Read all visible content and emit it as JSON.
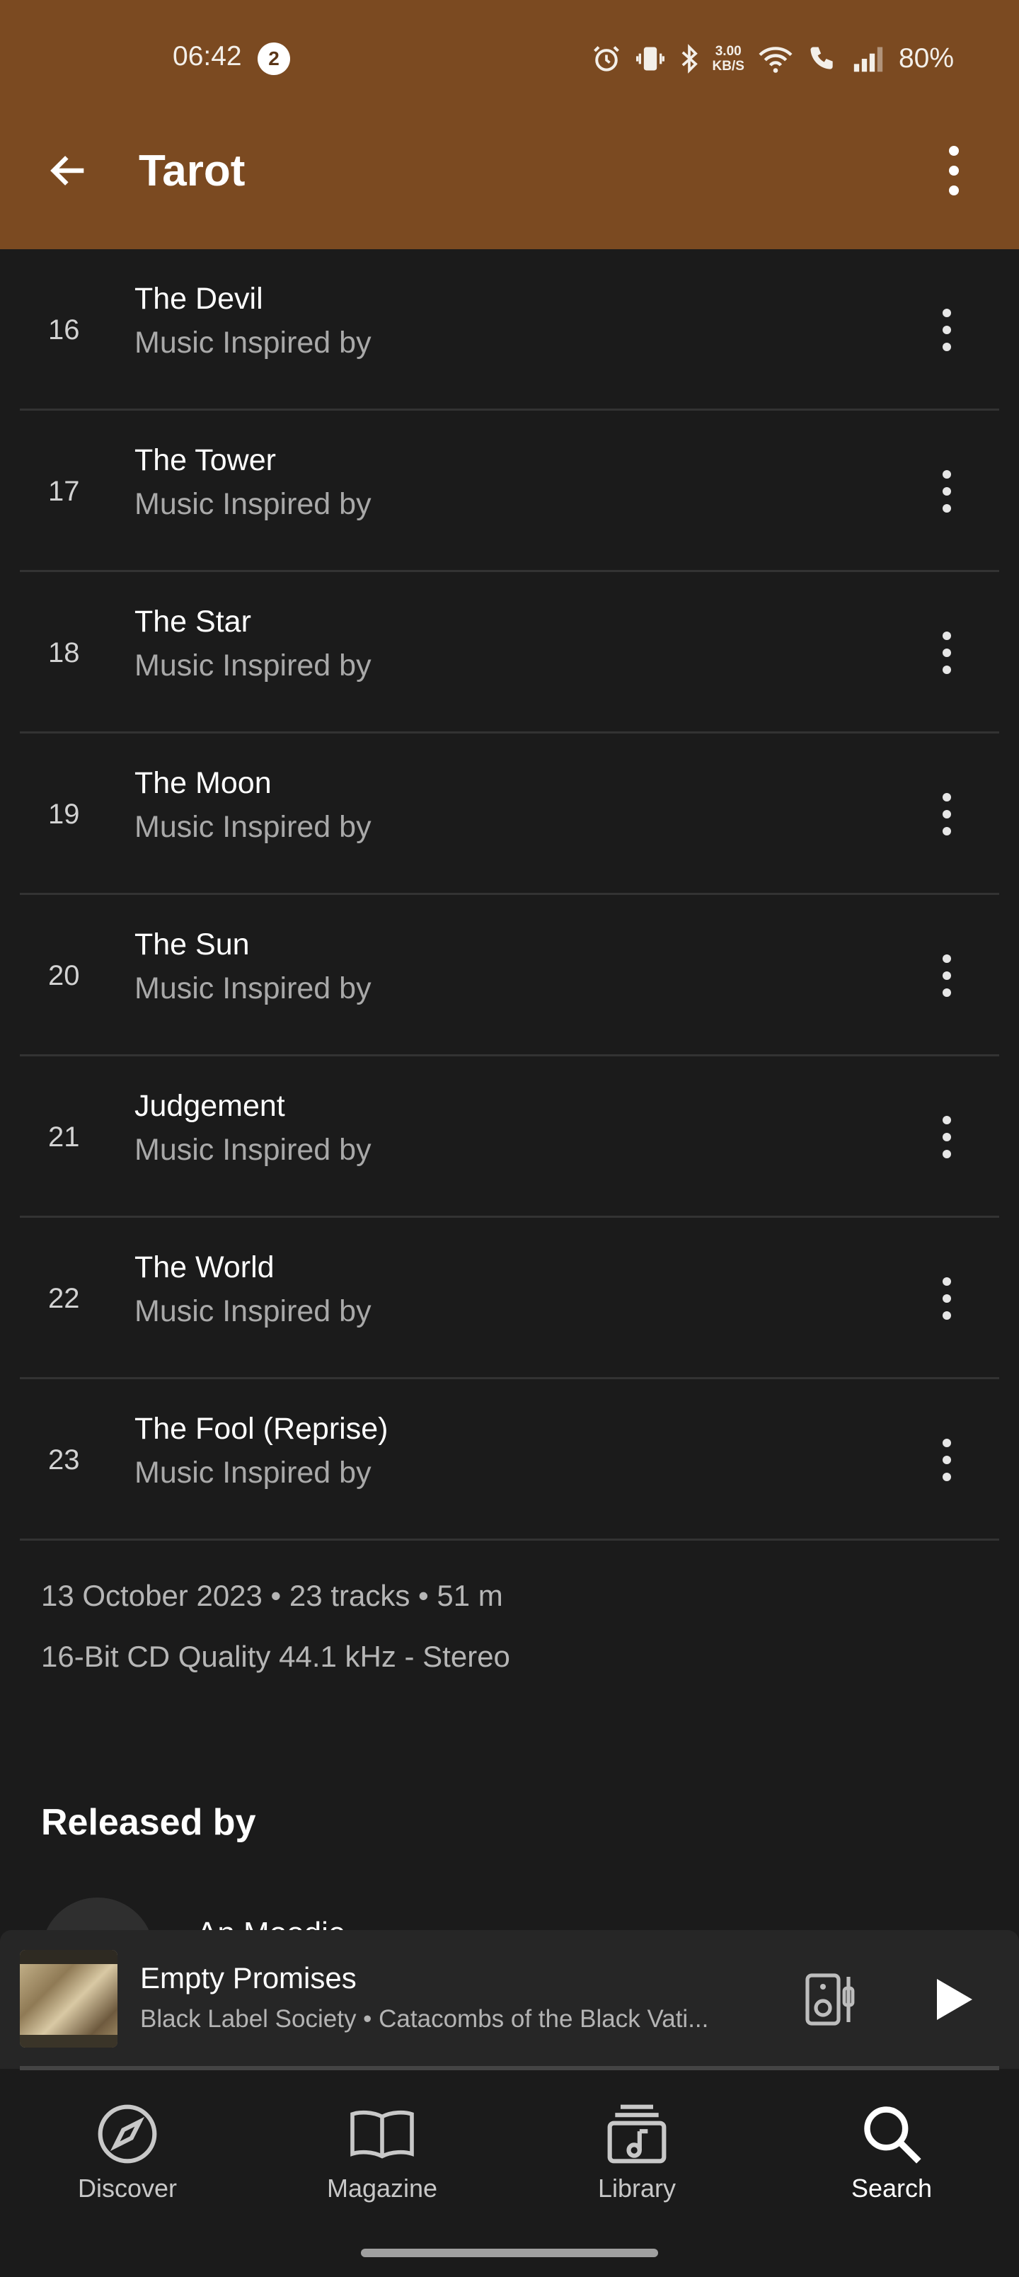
{
  "status_bar": {
    "time": "06:42",
    "notification_count": "2",
    "net_speed_value": "3.00",
    "net_speed_unit": "KB/S",
    "battery": "80%"
  },
  "header": {
    "title": "Tarot",
    "background_color": "#7b4a21"
  },
  "tracks": [
    {
      "number": "16",
      "title": "The Devil",
      "subtitle": "Music Inspired by"
    },
    {
      "number": "17",
      "title": "The Tower",
      "subtitle": "Music Inspired by"
    },
    {
      "number": "18",
      "title": "The Star",
      "subtitle": "Music Inspired by"
    },
    {
      "number": "19",
      "title": "The Moon",
      "subtitle": "Music Inspired by"
    },
    {
      "number": "20",
      "title": "The Sun",
      "subtitle": "Music Inspired by"
    },
    {
      "number": "21",
      "title": "Judgement",
      "subtitle": "Music Inspired by"
    },
    {
      "number": "22",
      "title": "The World",
      "subtitle": "Music Inspired by"
    },
    {
      "number": "23",
      "title": "The Fool (Reprise)",
      "subtitle": "Music Inspired by"
    }
  ],
  "album_meta": {
    "release_info": "13 October 2023 • 23 tracks • 51 m",
    "quality": "16-Bit CD Quality 44.1 kHz - Stereo"
  },
  "released_by": {
    "heading": "Released by",
    "artist_name_partial": "An Moodie"
  },
  "mini_player": {
    "title": "Empty Promises",
    "subtitle": "Black Label Society • Catacombs of the Black Vati..."
  },
  "bottom_nav": [
    {
      "label": "Discover",
      "icon": "compass-icon"
    },
    {
      "label": "Magazine",
      "icon": "book-icon"
    },
    {
      "label": "Library",
      "icon": "library-icon"
    },
    {
      "label": "Search",
      "icon": "search-icon",
      "active": true
    }
  ]
}
